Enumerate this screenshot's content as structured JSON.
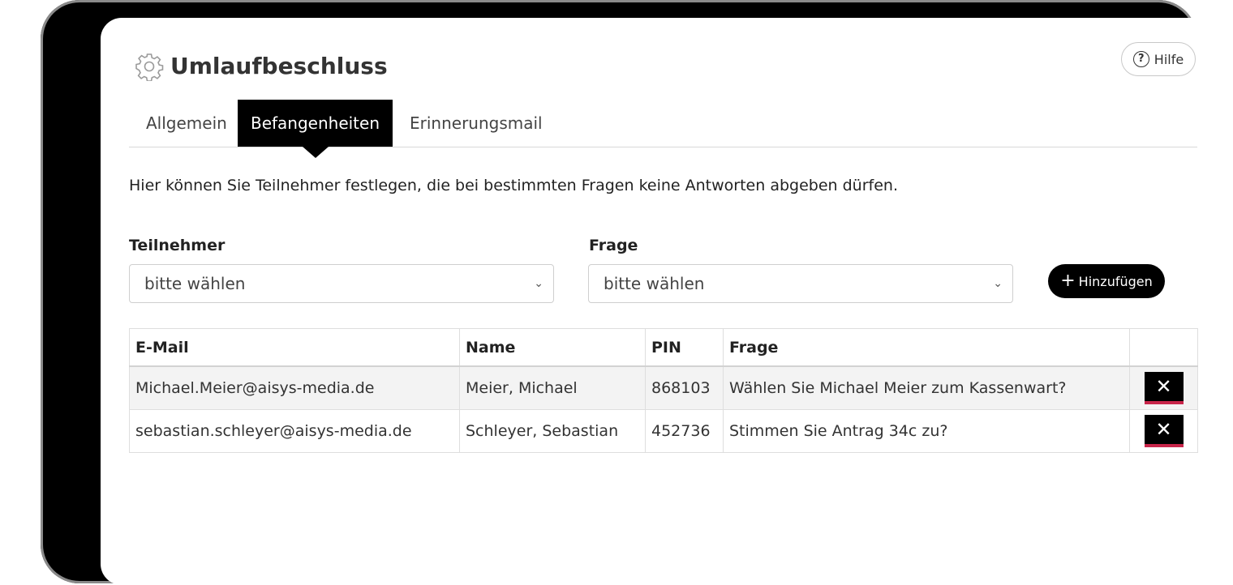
{
  "header": {
    "title": "Umlaufbeschluss",
    "help_label": "Hilfe",
    "help_glyph": "?",
    "icon": "gear-icon"
  },
  "tabs": [
    {
      "label": "Allgemein",
      "active": false
    },
    {
      "label": "Befangenheiten",
      "active": true
    },
    {
      "label": "Erinnerungsmail",
      "active": false
    }
  ],
  "description": "Hier können Sie Teilnehmer festlegen, die bei bestimmten Fragen keine Antworten abgeben dürfen.",
  "form": {
    "participant_label": "Teilnehmer",
    "participant_value": "bitte wählen",
    "question_label": "Frage",
    "question_value": "bitte wählen",
    "chevron": "⌄",
    "add_plus": "+",
    "add_label": "Hinzufügen"
  },
  "table": {
    "headers": [
      "E-Mail",
      "Name",
      "PIN",
      "Frage",
      ""
    ],
    "rows": [
      {
        "email": "Michael.Meier@aisys-media.de",
        "name": "Meier, Michael",
        "pin": "868103",
        "question": "Wählen Sie Michael Meier zum Kassenwart?",
        "delete": "✕"
      },
      {
        "email": "sebastian.schleyer@aisys-media.de",
        "name": "Schleyer, Sebastian",
        "pin": "452736",
        "question": "Stimmen Sie Antrag 34c zu?",
        "delete": "✕"
      }
    ]
  },
  "colors": {
    "accent": "#000000",
    "delete_underline": "#c8254a",
    "row_alt": "#f3f3f3"
  }
}
